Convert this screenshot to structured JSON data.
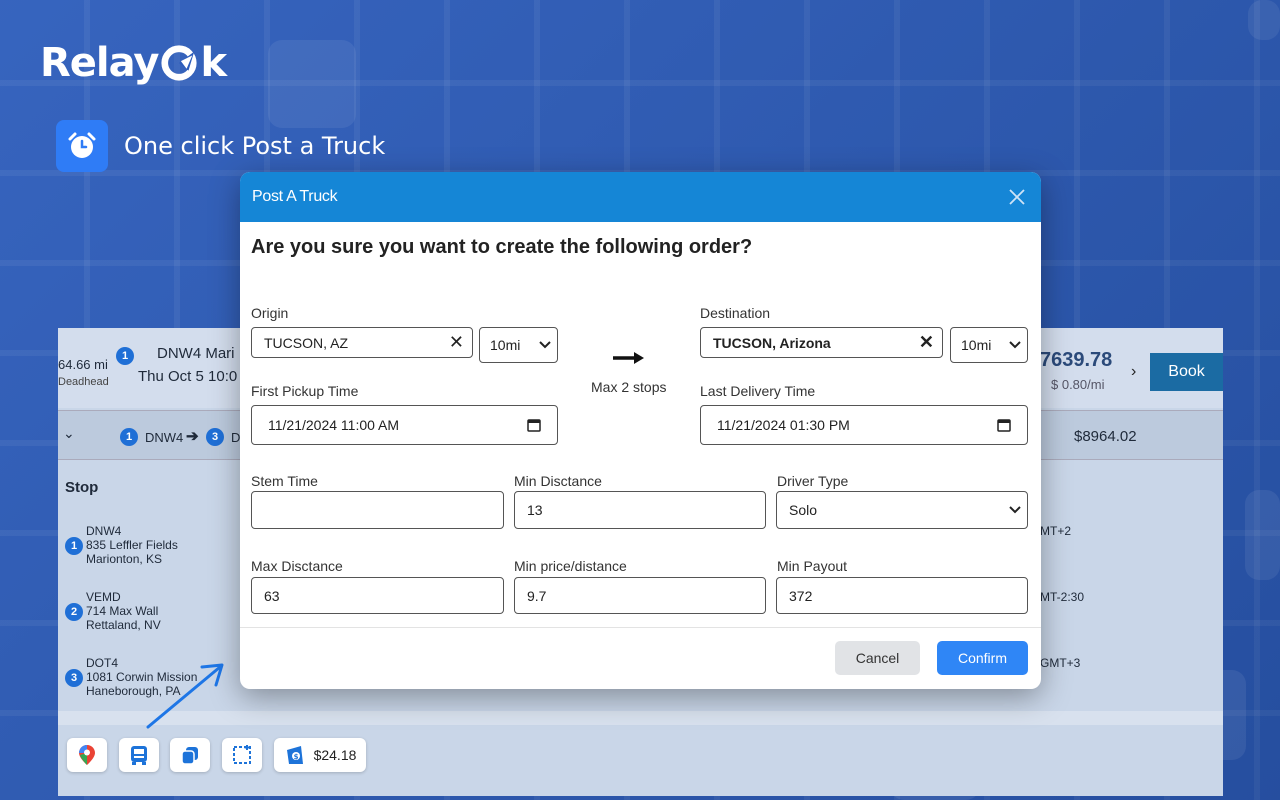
{
  "brand": {
    "name_prefix": "Relay",
    "name_suffix": "k"
  },
  "feature": {
    "text": "One click Post a Truck",
    "icon": "alarm-clock-icon"
  },
  "app": {
    "deadhead_miles": "64.66 mi",
    "deadhead_label": "Deadhead",
    "stop_badge": "1",
    "load_title": "DNW4 Mari",
    "load_date": "Thu Oct 5 10:0",
    "price": "7639.78",
    "price_per_mile": "$ 0.80/mi",
    "book_label": "Book",
    "route_from": "DNW4",
    "route_to_prefix": "D",
    "route_badge_from": "1",
    "route_badge_to": "3",
    "row2_total": "$8964.02",
    "stop_header": "Stop",
    "stops": [
      {
        "num": "1",
        "code": "DNW4",
        "line1": "835 Leffler Fields",
        "line2": "Marionton, KS",
        "tz": "MT+2"
      },
      {
        "num": "2",
        "code": "VEMD",
        "line1": "714 Max Wall",
        "line2": "Rettaland, NV",
        "tz": "MT-2:30"
      },
      {
        "num": "3",
        "code": "DOT4",
        "line1": "1081 Corwin Mission",
        "line2": "Haneborough, PA",
        "tz": "GMT+3"
      }
    ]
  },
  "toolbar": {
    "balance": "$24.18",
    "icons": [
      "map-pin-icon",
      "truck-icon",
      "copy-icon",
      "crop-icon",
      "wallet-icon"
    ]
  },
  "modal": {
    "title": "Post A Truck",
    "question": "Are you sure you want to create the following order?",
    "origin_label": "Origin",
    "origin_value": "TUCSON, AZ",
    "origin_radius": "10mi",
    "destination_label": "Destination",
    "destination_value": "TUCSON, Arizona",
    "destination_radius": "10mi",
    "max_stops": "Max 2 stops",
    "first_pickup_label": "First Pickup Time",
    "first_pickup_value": "11/21/2024 11:00 AM",
    "last_delivery_label": "Last Delivery Time",
    "last_delivery_value": "11/21/2024 01:30 PM",
    "stem_time_label": "Stem Time",
    "stem_time_value": "",
    "min_distance_label": "Min Disctance",
    "min_distance_value": "13",
    "driver_type_label": "Driver Type",
    "driver_type_value": "Solo",
    "max_distance_label": "Max Disctance",
    "max_distance_value": "63",
    "min_price_label": "Min price/distance",
    "min_price_value": "9.7",
    "min_payout_label": "Min Payout",
    "min_payout_value": "372",
    "cancel_label": "Cancel",
    "confirm_label": "Confirm"
  },
  "colors": {
    "accent": "#1586d6",
    "confirm": "#2f86f6",
    "background": "#2c5cbb"
  }
}
